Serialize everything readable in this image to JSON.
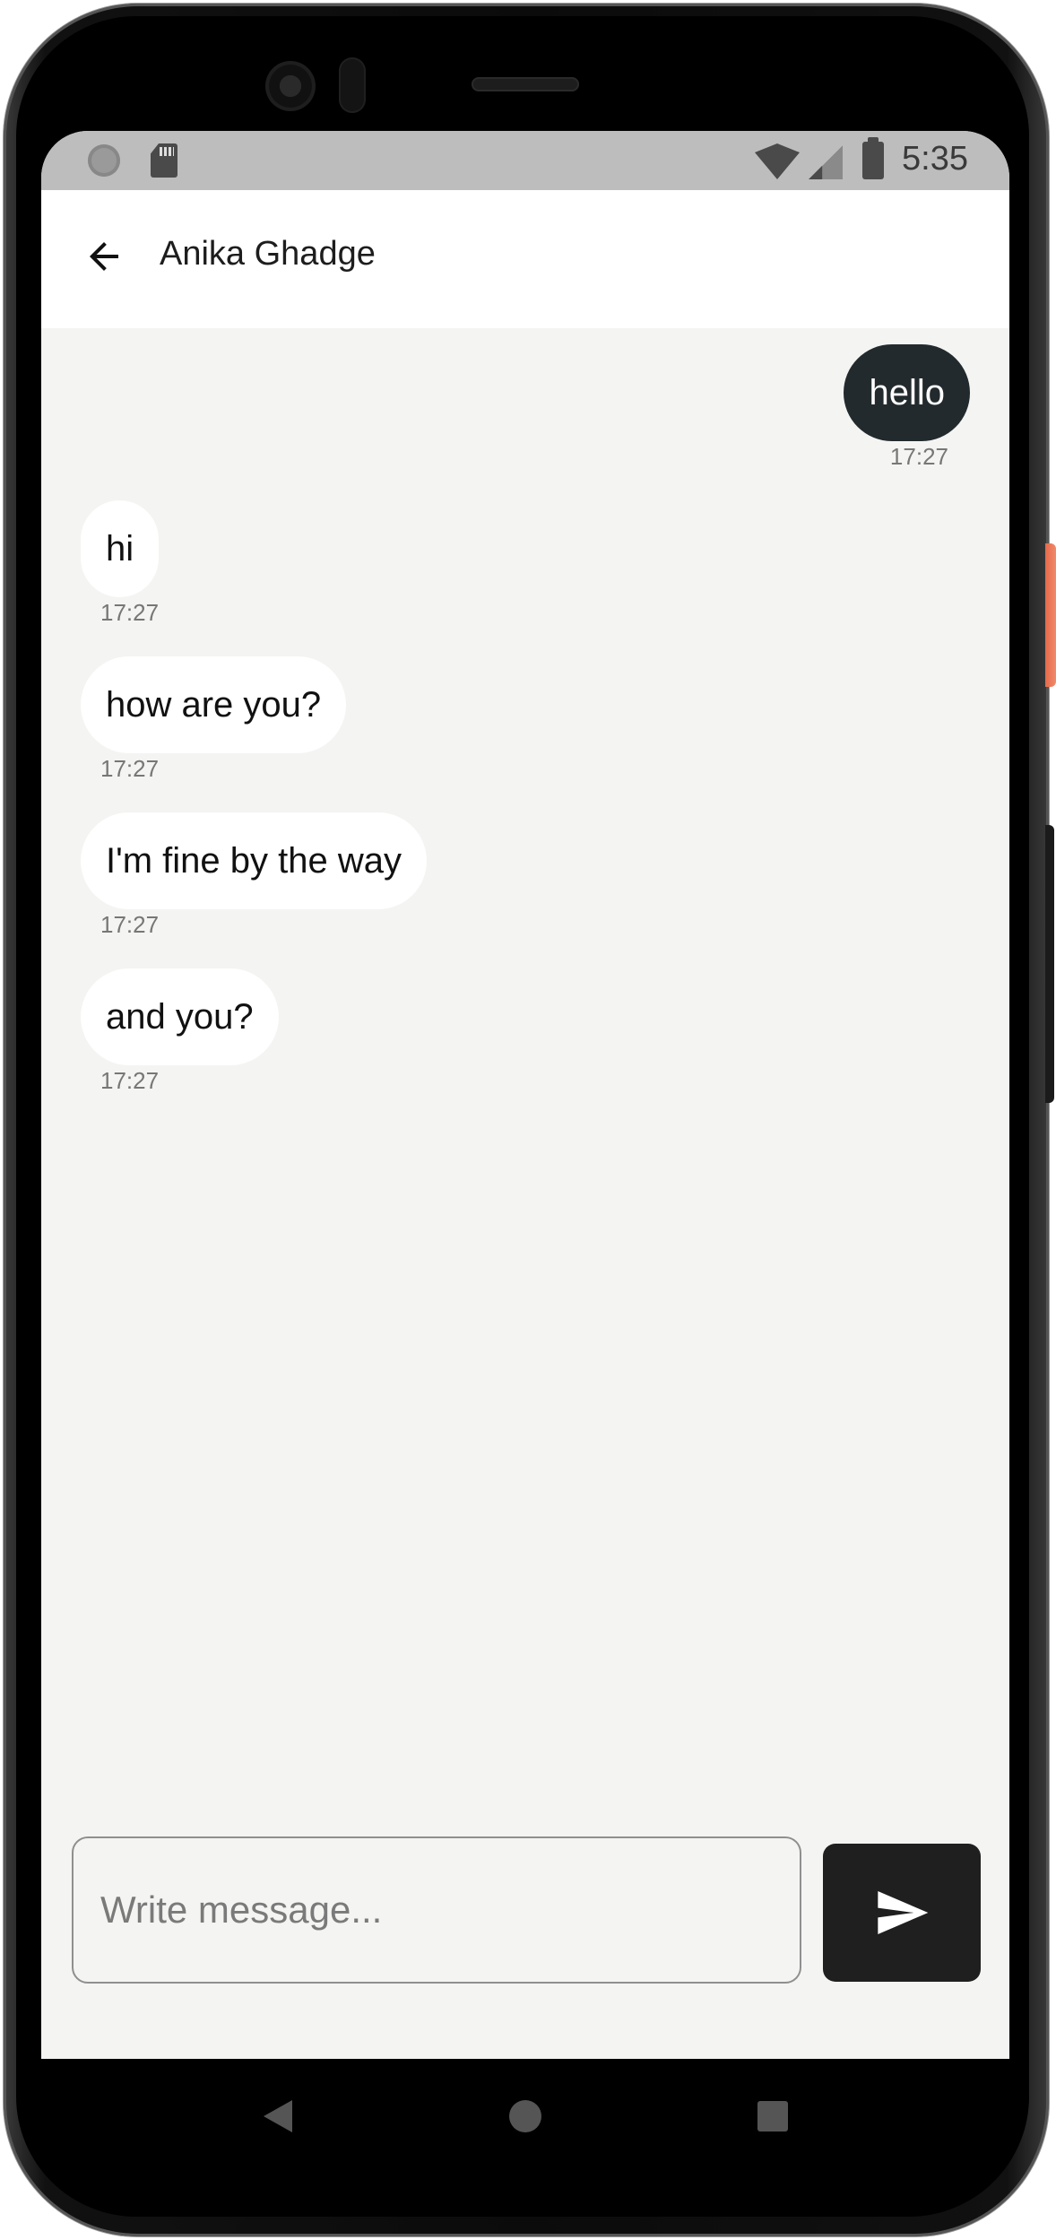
{
  "status_bar": {
    "time": "5:35",
    "left_icons": [
      "circle-notification-icon",
      "sd-card-icon"
    ],
    "right_icons": [
      "wifi-icon",
      "cell-signal-icon",
      "battery-icon"
    ]
  },
  "app_bar": {
    "back_icon": "arrow-left-icon",
    "title": "Anika Ghadge"
  },
  "messages": [
    {
      "text": "hello",
      "time": "17:27",
      "direction": "outgoing"
    },
    {
      "text": "hi",
      "time": "17:27",
      "direction": "incoming"
    },
    {
      "text": "how are you?",
      "time": "17:27",
      "direction": "incoming"
    },
    {
      "text": "I'm fine by the way",
      "time": "17:27",
      "direction": "incoming"
    },
    {
      "text": "and you?",
      "time": "17:27",
      "direction": "incoming"
    }
  ],
  "composer": {
    "placeholder": "Write message...",
    "value": "",
    "send_icon": "send-icon"
  },
  "nav_bar": {
    "icons": [
      "nav-back-icon",
      "nav-home-icon",
      "nav-recents-icon"
    ]
  },
  "colors": {
    "chat_background": "#f4f4f2",
    "outgoing_bubble": "#222a2d",
    "incoming_bubble": "#ffffff",
    "send_button": "#1f1f1f"
  }
}
